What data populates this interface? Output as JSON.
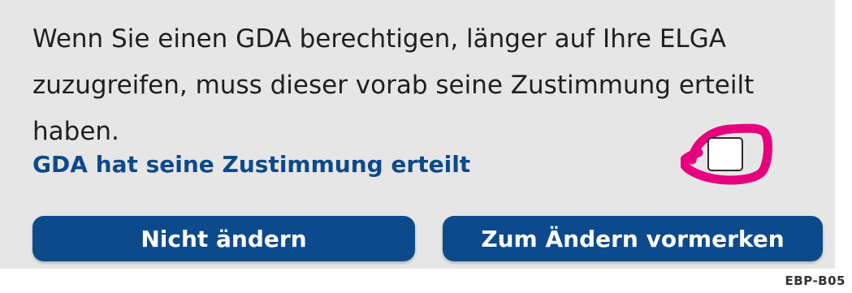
{
  "dialog": {
    "description": "Wenn Sie einen GDA berechtigen, länger auf Ihre ELGA zuzugreifen, muss dieser vorab seine Zustimmung erteilt haben.",
    "consent_label": "GDA hat seine Zustimmung erteilt",
    "consent_checked": false,
    "highlight_color": "#e6007e",
    "accent_color": "#0d4a8c"
  },
  "buttons": {
    "keep_label": "Nicht ändern",
    "change_label": "Zum Ändern vormerken"
  },
  "footer": {
    "screen_code": "EBP-B05"
  }
}
